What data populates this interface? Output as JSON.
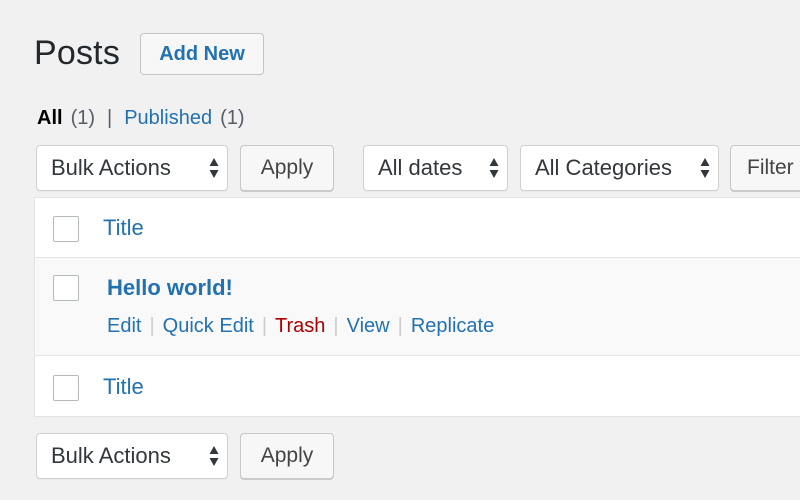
{
  "page": {
    "title": "Posts",
    "add_new_label": "Add New"
  },
  "views": {
    "all_label": "All",
    "all_count": "(1)",
    "separator": "|",
    "published_label": "Published",
    "published_count": "(1)"
  },
  "top_nav": {
    "bulk_actions": "Bulk Actions",
    "apply_label": "Apply",
    "dates_filter": "All dates",
    "categories_filter": "All Categories",
    "filter_label": "Filter"
  },
  "table": {
    "header_title": "Title",
    "footer_title": "Title",
    "rows": [
      {
        "title": "Hello world!",
        "actions": {
          "edit": "Edit",
          "quick_edit": "Quick Edit",
          "trash": "Trash",
          "view": "View",
          "replicate": "Replicate"
        },
        "separator": "|"
      }
    ]
  },
  "bottom_nav": {
    "bulk_actions": "Bulk Actions",
    "apply_label": "Apply"
  },
  "colors": {
    "link": "#2271b1",
    "trash": "#aa0000",
    "background": "#f1f1f1"
  },
  "icons": {
    "select_arrows": "up-down-arrows-icon"
  }
}
